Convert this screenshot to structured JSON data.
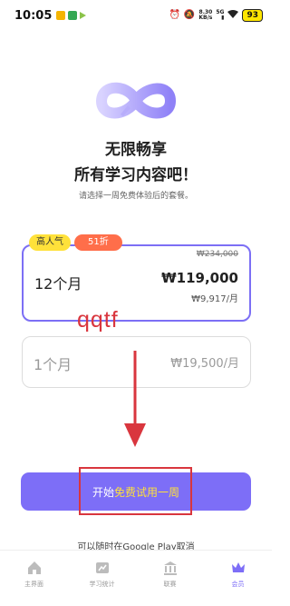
{
  "status_bar": {
    "time": "10:05",
    "net_speed_value": "8.30",
    "net_speed_unit": "KB/s",
    "network": "5G",
    "battery": "93"
  },
  "headline": {
    "line1": "无限畅享",
    "line2": "所有学习内容吧！"
  },
  "subtitle": "请选择一周免费体验后的套餐。",
  "plans": [
    {
      "name": "12个月",
      "badge_popular": "高人气",
      "badge_discount": "51折",
      "original_price": "₩234,000",
      "price": "₩119,000",
      "monthly": "₩9,917/月",
      "selected": true
    },
    {
      "name": "1个月",
      "price": "₩19,500/月",
      "selected": false
    }
  ],
  "annotation": {
    "text": "qqtf"
  },
  "cta": {
    "prefix": "开始",
    "highlight": "免费试用一周"
  },
  "cancel_note": "可以随时在Google Play取消",
  "bottom_nav": {
    "items": [
      {
        "label": "主界面",
        "icon": "home-icon"
      },
      {
        "label": "学习统计",
        "icon": "stats-icon"
      },
      {
        "label": "联赛",
        "icon": "league-icon"
      },
      {
        "label": "会员",
        "icon": "crown-icon",
        "active": true
      }
    ]
  },
  "colors": {
    "accent": "#7d6ef7",
    "highlight": "#ffe13a",
    "annotation": "#d9363e",
    "discount": "#ff6e4a"
  }
}
